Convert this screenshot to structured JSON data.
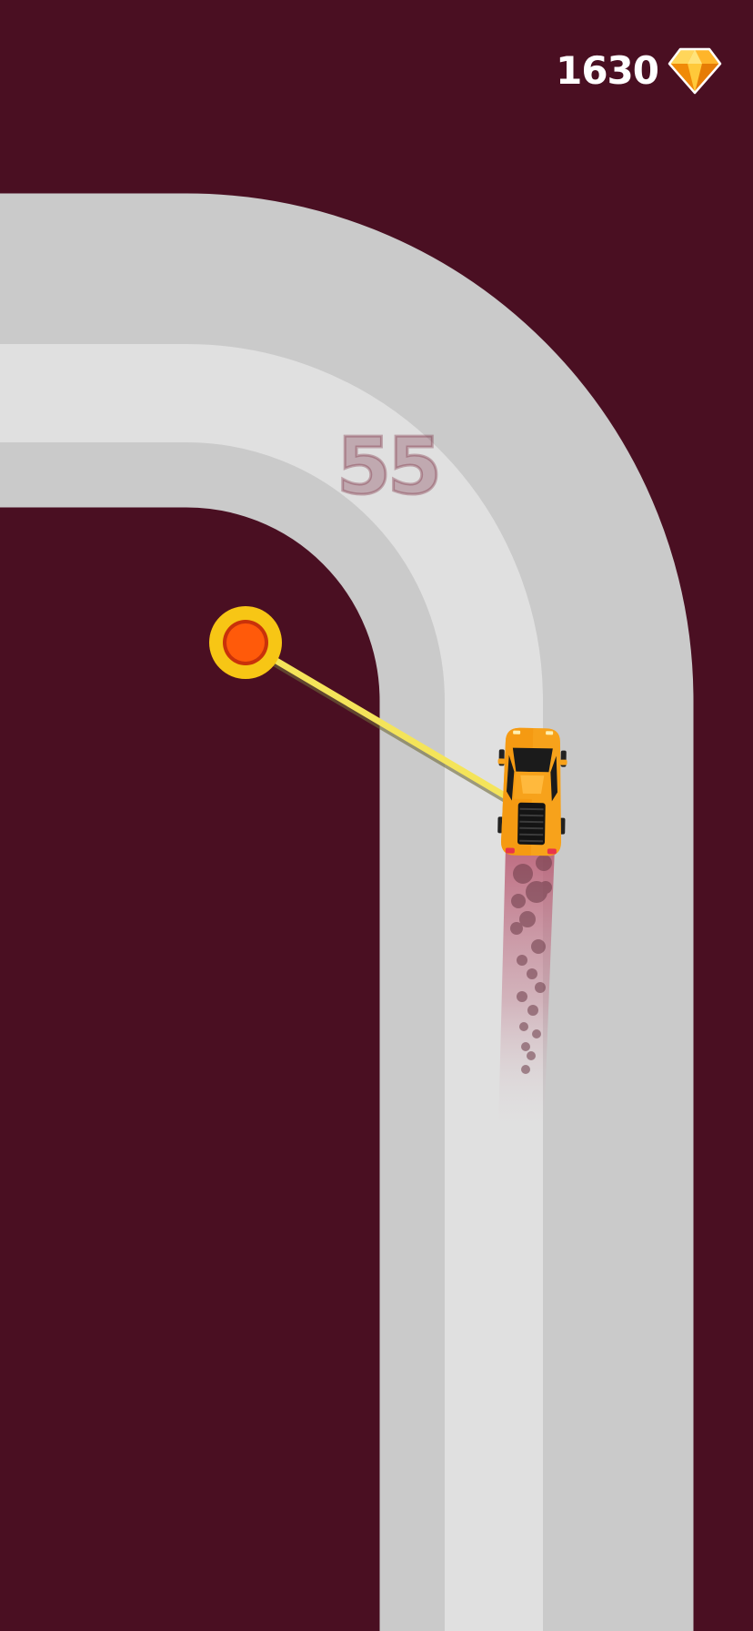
{
  "hud": {
    "gem_count": "1630",
    "gem_icon": "diamond-gem-icon"
  },
  "score": "55",
  "colors": {
    "background": "#4a0f22",
    "track_outer": "#cacaca",
    "track_inner": "#e0e0e0",
    "car_body": "#f7a21b",
    "pivot_outer": "#f7c615",
    "pivot_inner": "#ff5a0a",
    "tether": "#f4e45a"
  }
}
